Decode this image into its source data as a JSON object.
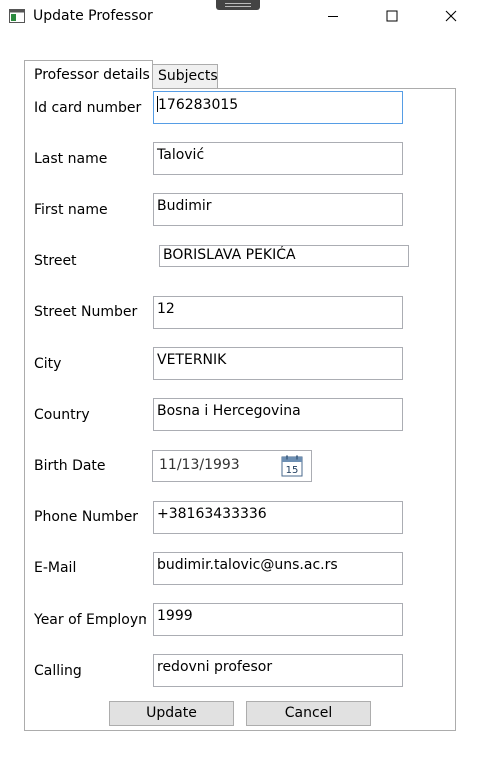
{
  "window": {
    "title": "Update Professor",
    "controls": [
      "minimize-icon",
      "maximize-icon",
      "close-icon"
    ]
  },
  "tabs": [
    {
      "label": "Professor details",
      "selected": true
    },
    {
      "label": "Subjects",
      "selected": false
    }
  ],
  "form": {
    "id_card": {
      "label": "Id card number",
      "value": "176283015"
    },
    "last_name": {
      "label": "Last name",
      "value": "Talović"
    },
    "first_name": {
      "label": "First name",
      "value": "Budimir"
    },
    "street": {
      "label": "Street",
      "value": "BORISLAVA PEKIĆA"
    },
    "street_number": {
      "label": "Street Number",
      "value": "12"
    },
    "city": {
      "label": "City",
      "value": "VETERNIK"
    },
    "country": {
      "label": "Country",
      "value": "Bosna i Hercegovina"
    },
    "birth_date": {
      "label": "Birth Date",
      "value": "11/13/1993",
      "calendar_day": "15"
    },
    "phone": {
      "label": "Phone Number",
      "value": "+38163433336"
    },
    "email": {
      "label": "E-Mail",
      "value": "budimir.talovic@uns.ac.rs"
    },
    "year_employment": {
      "label": "Year of Employment",
      "value": "1999"
    },
    "calling": {
      "label": "Calling",
      "value": "redovni profesor"
    }
  },
  "buttons": {
    "update": "Update",
    "cancel": "Cancel"
  },
  "colors": {
    "focus_border": "#569de5",
    "field_border": "#abadb3",
    "button_bg": "#e1e1e1"
  }
}
